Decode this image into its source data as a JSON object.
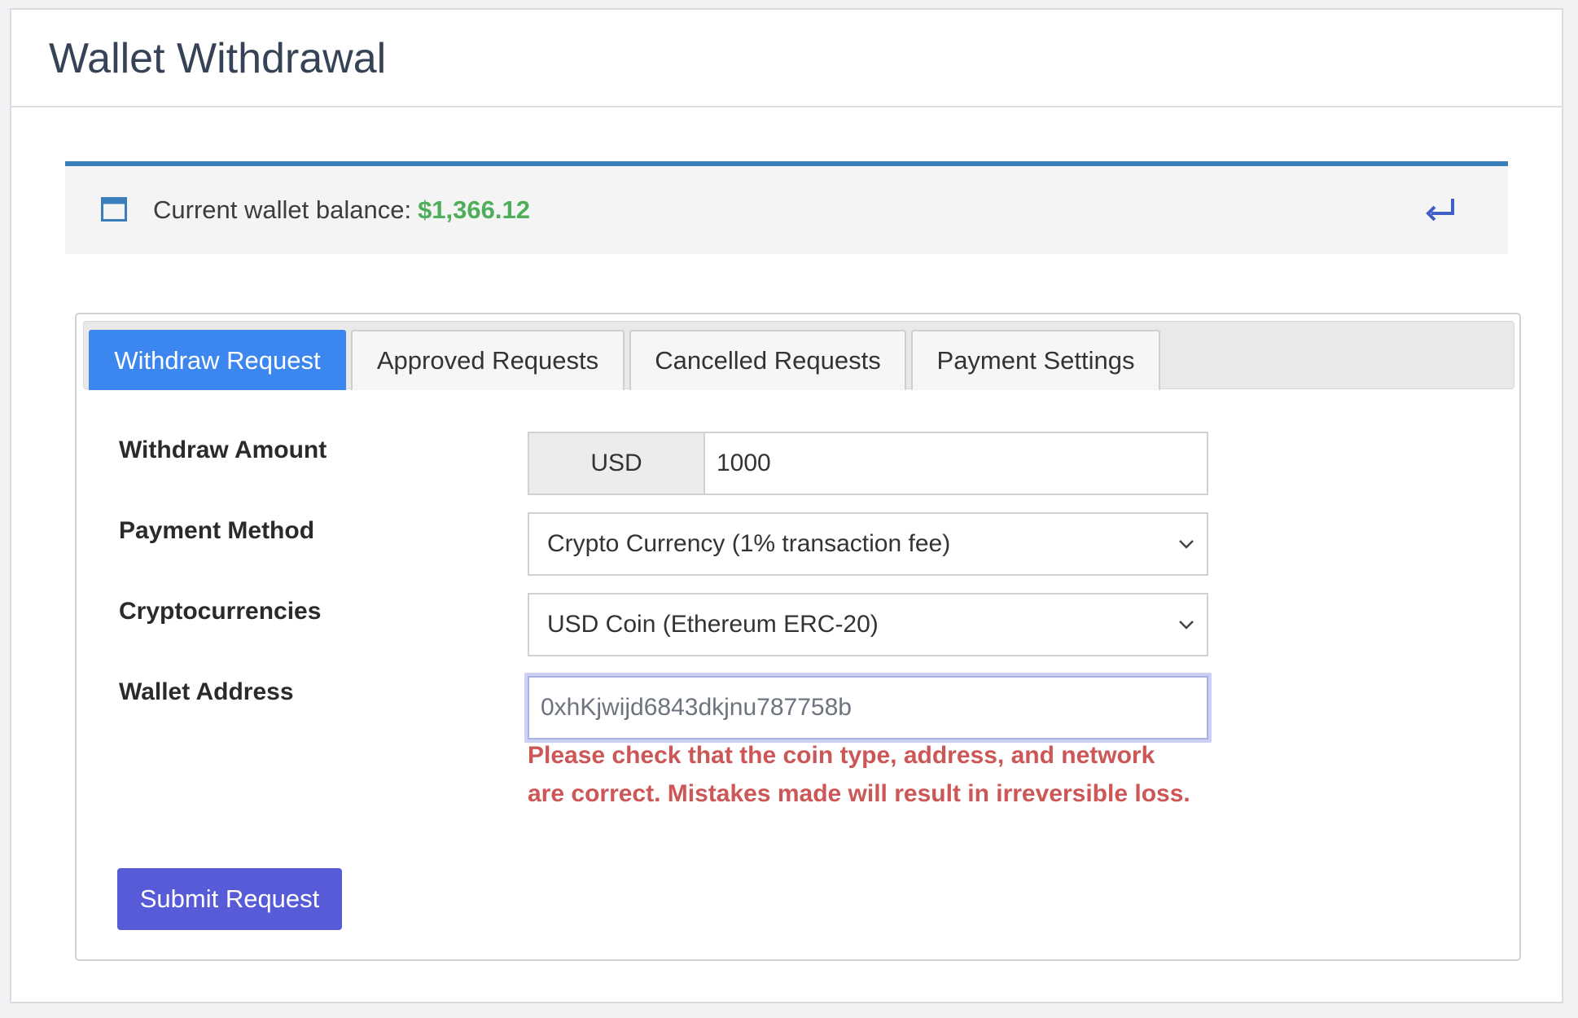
{
  "page": {
    "title": "Wallet Withdrawal"
  },
  "balance": {
    "label": "Current wallet balance:",
    "amount": "$1,366.12",
    "amount_color": "#4fae5b",
    "icon": "window-icon",
    "action_icon": "return-arrow-icon"
  },
  "tabs": [
    {
      "label": "Withdraw Request",
      "active": true
    },
    {
      "label": "Approved Requests",
      "active": false
    },
    {
      "label": "Cancelled Requests",
      "active": false
    },
    {
      "label": "Payment Settings",
      "active": false
    }
  ],
  "form": {
    "amount": {
      "label": "Withdraw Amount",
      "currency": "USD",
      "value": "1000"
    },
    "payment_method": {
      "label": "Payment Method",
      "selected": "Crypto Currency (1% transaction fee)"
    },
    "cryptocurrency": {
      "label": "Cryptocurrencies",
      "selected": "USD Coin (Ethereum ERC-20)"
    },
    "wallet": {
      "label": "Wallet Address",
      "value": "0xhKjwijd6843dkjnu787758b"
    },
    "warning": "Please check that the coin type, address, and network are correct. Mistakes made will result in irreversible loss.",
    "submit_label": "Submit Request"
  },
  "colors": {
    "accent_blue": "#3c86f0",
    "header_border": "#3a7ebc",
    "submit": "#575bd7",
    "warning": "#cd5656"
  }
}
